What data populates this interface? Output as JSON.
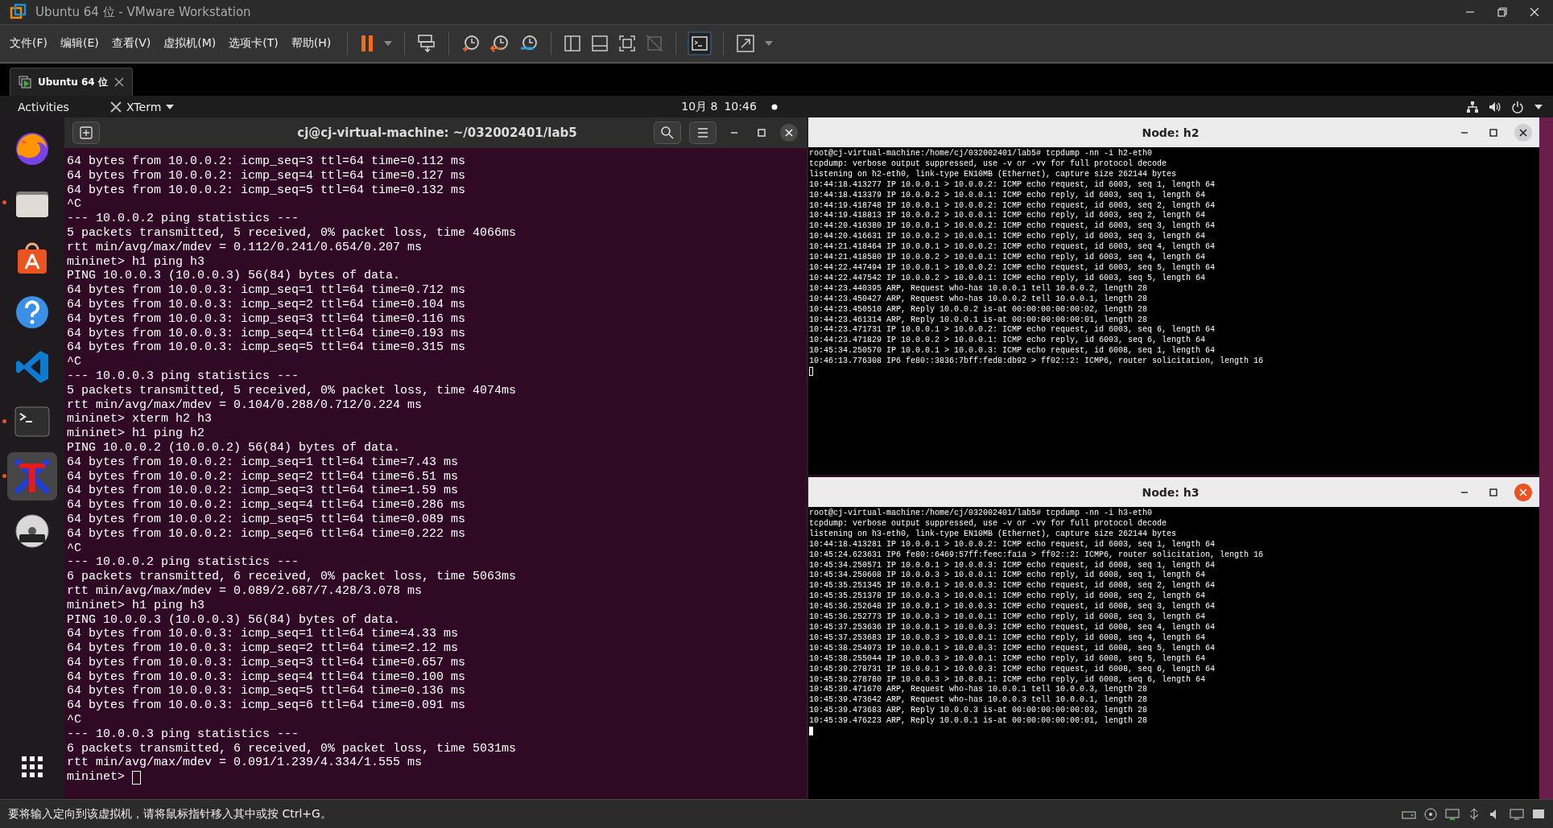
{
  "window": {
    "title": "Ubuntu 64 位 - VMware Workstation"
  },
  "menu": [
    "文件(F)",
    "编辑(E)",
    "查看(V)",
    "虚拟机(M)",
    "选项卡(T)",
    "帮助(H)"
  ],
  "tabs": [
    {
      "label": "Ubuntu 64 位",
      "selected": true
    }
  ],
  "top_bar": {
    "activities": "Activities",
    "app": "XTerm",
    "date": "10月 8",
    "time": "10:46"
  },
  "dock": [
    {
      "kind": "firefox",
      "running": false,
      "selected": false
    },
    {
      "kind": "files",
      "running": true,
      "selected": false
    },
    {
      "kind": "software",
      "running": false,
      "selected": false
    },
    {
      "kind": "help",
      "running": false,
      "selected": false
    },
    {
      "kind": "vscode",
      "running": false,
      "selected": false
    },
    {
      "kind": "terminal",
      "running": true,
      "selected": false
    },
    {
      "kind": "xterm",
      "running": true,
      "selected": true
    },
    {
      "kind": "dvd",
      "running": false,
      "selected": false
    },
    {
      "kind": "apps",
      "running": false,
      "selected": false
    }
  ],
  "terminal": {
    "title": "cj@cj-virtual-machine: ~/032002401/lab5",
    "lines": [
      "64 bytes from 10.0.0.2: icmp_seq=3 ttl=64 time=0.112 ms",
      "64 bytes from 10.0.0.2: icmp_seq=4 ttl=64 time=0.127 ms",
      "64 bytes from 10.0.0.2: icmp_seq=5 ttl=64 time=0.132 ms",
      "^C",
      "--- 10.0.0.2 ping statistics ---",
      "5 packets transmitted, 5 received, 0% packet loss, time 4066ms",
      "rtt min/avg/max/mdev = 0.112/0.241/0.654/0.207 ms",
      "mininet> h1 ping h3",
      "PING 10.0.0.3 (10.0.0.3) 56(84) bytes of data.",
      "64 bytes from 10.0.0.3: icmp_seq=1 ttl=64 time=0.712 ms",
      "64 bytes from 10.0.0.3: icmp_seq=2 ttl=64 time=0.104 ms",
      "64 bytes from 10.0.0.3: icmp_seq=3 ttl=64 time=0.116 ms",
      "64 bytes from 10.0.0.3: icmp_seq=4 ttl=64 time=0.193 ms",
      "64 bytes from 10.0.0.3: icmp_seq=5 ttl=64 time=0.315 ms",
      "^C",
      "--- 10.0.0.3 ping statistics ---",
      "5 packets transmitted, 5 received, 0% packet loss, time 4074ms",
      "rtt min/avg/max/mdev = 0.104/0.288/0.712/0.224 ms",
      "mininet> xterm h2 h3",
      "mininet> h1 ping h2",
      "PING 10.0.0.2 (10.0.0.2) 56(84) bytes of data.",
      "64 bytes from 10.0.0.2: icmp_seq=1 ttl=64 time=7.43 ms",
      "64 bytes from 10.0.0.2: icmp_seq=2 ttl=64 time=6.51 ms",
      "64 bytes from 10.0.0.2: icmp_seq=3 ttl=64 time=1.59 ms",
      "64 bytes from 10.0.0.2: icmp_seq=4 ttl=64 time=0.286 ms",
      "64 bytes from 10.0.0.2: icmp_seq=5 ttl=64 time=0.089 ms",
      "64 bytes from 10.0.0.2: icmp_seq=6 ttl=64 time=0.222 ms",
      "^C",
      "--- 10.0.0.2 ping statistics ---",
      "6 packets transmitted, 6 received, 0% packet loss, time 5063ms",
      "rtt min/avg/max/mdev = 0.089/2.687/7.428/3.078 ms",
      "mininet> h1 ping h3",
      "PING 10.0.0.3 (10.0.0.3) 56(84) bytes of data.",
      "64 bytes from 10.0.0.3: icmp_seq=1 ttl=64 time=4.33 ms",
      "64 bytes from 10.0.0.3: icmp_seq=2 ttl=64 time=2.12 ms",
      "64 bytes from 10.0.0.3: icmp_seq=3 ttl=64 time=0.657 ms",
      "64 bytes from 10.0.0.3: icmp_seq=4 ttl=64 time=0.100 ms",
      "64 bytes from 10.0.0.3: icmp_seq=5 ttl=64 time=0.136 ms",
      "64 bytes from 10.0.0.3: icmp_seq=6 ttl=64 time=0.091 ms",
      "^C",
      "--- 10.0.0.3 ping statistics ---",
      "6 packets transmitted, 6 received, 0% packet loss, time 5031ms",
      "rtt min/avg/max/mdev = 0.091/1.239/4.334/1.555 ms"
    ],
    "prompt": "mininet>"
  },
  "xterms": [
    {
      "title": "Node: h2",
      "focused": false,
      "lines": [
        "root@cj-virtual-machine:/home/cj/032002401/lab5# tcpdump -nn -i h2-eth0",
        "tcpdump: verbose output suppressed, use -v or -vv for full protocol decode",
        "listening on h2-eth0, link-type EN10MB (Ethernet), capture size 262144 bytes",
        "10:44:18.413277 IP 10.0.0.1 > 10.0.0.2: ICMP echo request, id 6003, seq 1, length 64",
        "10:44:18.413379 IP 10.0.0.2 > 10.0.0.1: ICMP echo reply, id 6003, seq 1, length 64",
        "10:44:19.418748 IP 10.0.0.1 > 10.0.0.2: ICMP echo request, id 6003, seq 2, length 64",
        "10:44:19.418813 IP 10.0.0.2 > 10.0.0.1: ICMP echo reply, id 6003, seq 2, length 64",
        "10:44:20.416380 IP 10.0.0.1 > 10.0.0.2: ICMP echo request, id 6003, seq 3, length 64",
        "10:44:20.416631 IP 10.0.0.2 > 10.0.0.1: ICMP echo reply, id 6003, seq 3, length 64",
        "10:44:21.418464 IP 10.0.0.1 > 10.0.0.2: ICMP echo request, id 6003, seq 4, length 64",
        "10:44:21.418580 IP 10.0.0.2 > 10.0.0.1: ICMP echo reply, id 6003, seq 4, length 64",
        "10:44:22.447494 IP 10.0.0.1 > 10.0.0.2: ICMP echo request, id 6003, seq 5, length 64",
        "10:44:22.447542 IP 10.0.0.2 > 10.0.0.1: ICMP echo reply, id 6003, seq 5, length 64",
        "10:44:23.440395 ARP, Request who-has 10.0.0.1 tell 10.0.0.2, length 28",
        "10:44:23.450427 ARP, Request who-has 10.0.0.2 tell 10.0.0.1, length 28",
        "10:44:23.450510 ARP, Reply 10.0.0.2 is-at 00:00:00:00:00:02, length 28",
        "10:44:23.461314 ARP, Reply 10.0.0.1 is-at 00:00:00:00:00:01, length 28",
        "10:44:23.471731 IP 10.0.0.1 > 10.0.0.2: ICMP echo request, id 6003, seq 6, length 64",
        "10:44:23.471829 IP 10.0.0.2 > 10.0.0.1: ICMP echo reply, id 6003, seq 6, length 64",
        "10:45:34.250570 IP 10.0.0.1 > 10.0.0.3: ICMP echo request, id 6008, seq 1, length 64",
        "10:46:13.776308 IP6 fe80::3836:7bff:fed8:db92 > ff02::2: ICMP6, router solicitation, length 16"
      ]
    },
    {
      "title": "Node: h3",
      "focused": true,
      "lines": [
        "root@cj-virtual-machine:/home/cj/032002401/lab5# tcpdump -nn -i h3-eth0",
        "tcpdump: verbose output suppressed, use -v or -vv for full protocol decode",
        "listening on h3-eth0, link-type EN10MB (Ethernet), capture size 262144 bytes",
        "10:44:18.413281 IP 10.0.0.1 > 10.0.0.2: ICMP echo request, id 6003, seq 1, length 64",
        "10:45:24.623631 IP6 fe80::6469:57ff:feec:fa1a > ff02::2: ICMP6, router solicitation, length 16",
        "10:45:34.250571 IP 10.0.0.1 > 10.0.0.3: ICMP echo request, id 6008, seq 1, length 64",
        "10:45:34.250608 IP 10.0.0.3 > 10.0.0.1: ICMP echo reply, id 6008, seq 1, length 64",
        "10:45:35.251345 IP 10.0.0.1 > 10.0.0.3: ICMP echo request, id 6008, seq 2, length 64",
        "10:45:35.251378 IP 10.0.0.3 > 10.0.0.1: ICMP echo reply, id 6008, seq 2, length 64",
        "10:45:36.252648 IP 10.0.0.1 > 10.0.0.3: ICMP echo request, id 6008, seq 3, length 64",
        "10:45:36.252773 IP 10.0.0.3 > 10.0.0.1: ICMP echo reply, id 6008, seq 3, length 64",
        "10:45:37.253636 IP 10.0.0.1 > 10.0.0.3: ICMP echo request, id 6008, seq 4, length 64",
        "10:45:37.253683 IP 10.0.0.3 > 10.0.0.1: ICMP echo reply, id 6008, seq 4, length 64",
        "10:45:38.254973 IP 10.0.0.1 > 10.0.0.3: ICMP echo request, id 6008, seq 5, length 64",
        "10:45:38.255044 IP 10.0.0.3 > 10.0.0.1: ICMP echo reply, id 6008, seq 5, length 64",
        "10:45:39.278731 IP 10.0.0.1 > 10.0.0.3: ICMP echo request, id 6008, seq 6, length 64",
        "10:45:39.278780 IP 10.0.0.3 > 10.0.0.1: ICMP echo reply, id 6008, seq 6, length 64",
        "10:45:39.471670 ARP, Request who-has 10.0.0.1 tell 10.0.0.3, length 28",
        "10:45:39.473642 ARP, Request who-has 10.0.0.3 tell 10.0.0.1, length 28",
        "10:45:39.473683 ARP, Reply 10.0.0.3 is-at 00:00:00:00:00:03, length 28",
        "10:45:39.476223 ARP, Reply 10.0.0.1 is-at 00:00:00:00:00:01, length 28"
      ]
    }
  ],
  "status_bar": {
    "text": "要将输入定向到该虚拟机，请将鼠标指针移入其中或按 Ctrl+G。"
  }
}
